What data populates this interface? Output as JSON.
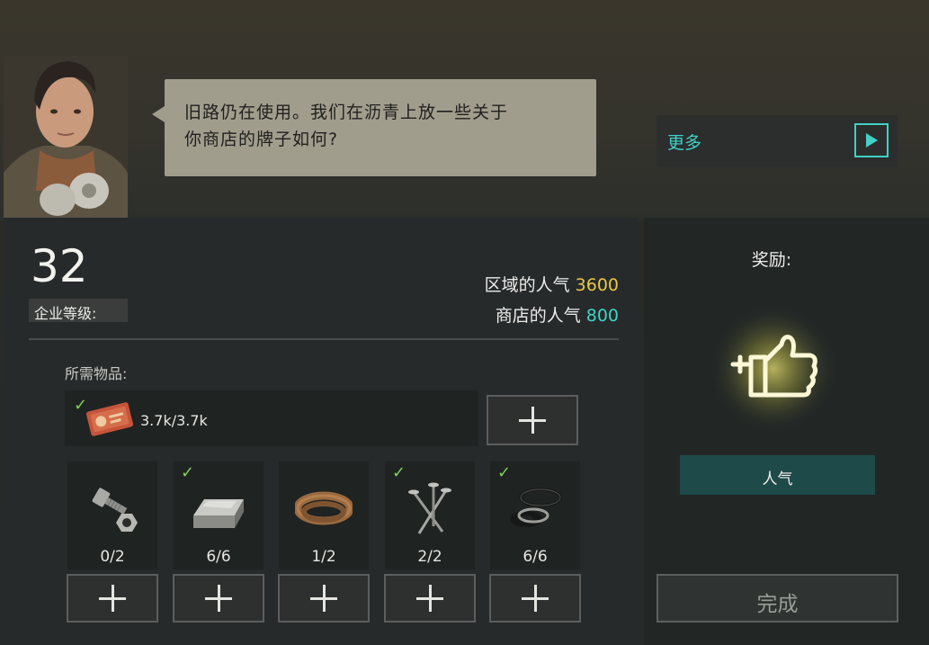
{
  "dialog": {
    "line1": "旧路仍在使用。我们在沥青上放一些关于",
    "line2": "你商店的牌子如何?"
  },
  "more_button": {
    "label": "更多",
    "icon": "play-icon",
    "accent": "#42d0c8"
  },
  "company": {
    "level": "32",
    "level_label": "企业等级:"
  },
  "popularity": {
    "area_label": "区域的人气",
    "area_value": "3600",
    "shop_label": "商店的人气",
    "shop_value": "800",
    "area_color": "#e8c64a",
    "shop_color": "#3fd3c6"
  },
  "requirements": {
    "label": "所需物品:",
    "main_item": {
      "icon": "voucher-card-icon",
      "quantity": "3.7k/3.7k",
      "complete": true
    },
    "items": [
      {
        "icon": "bolt-nut-icon",
        "count": "0/2",
        "complete": false
      },
      {
        "icon": "metal-ingot-icon",
        "count": "6/6",
        "complete": true
      },
      {
        "icon": "leather-belt-icon",
        "count": "1/2",
        "complete": false
      },
      {
        "icon": "nails-icon",
        "count": "2/2",
        "complete": true
      },
      {
        "icon": "washers-icon",
        "count": "6/6",
        "complete": true
      }
    ]
  },
  "reward": {
    "title": "奖励:",
    "icon": "thumbs-up-plus-icon",
    "tag": "人气"
  },
  "complete_button": {
    "label": "完成"
  }
}
